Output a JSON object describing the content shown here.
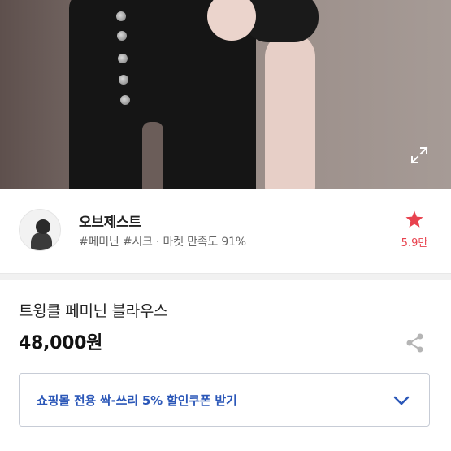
{
  "photo": {
    "expand_icon": "expand-arrows-icon"
  },
  "shop": {
    "name": "오브제스트",
    "tags": "#페미닌 #시크 · 마켓 만족도 91%",
    "favorite_count": "5.9만",
    "favorite_icon": "star-icon",
    "accent_color": "#e8424e"
  },
  "product": {
    "name": "트윙클 페미닌 블라우스",
    "price": "48,000원",
    "share_icon": "share-icon"
  },
  "coupon": {
    "label": "쇼핑몰 전용 싹-쓰리 5% 할인쿠폰 받기",
    "label_color": "#2b57b8",
    "chevron_icon": "chevron-down-icon"
  }
}
